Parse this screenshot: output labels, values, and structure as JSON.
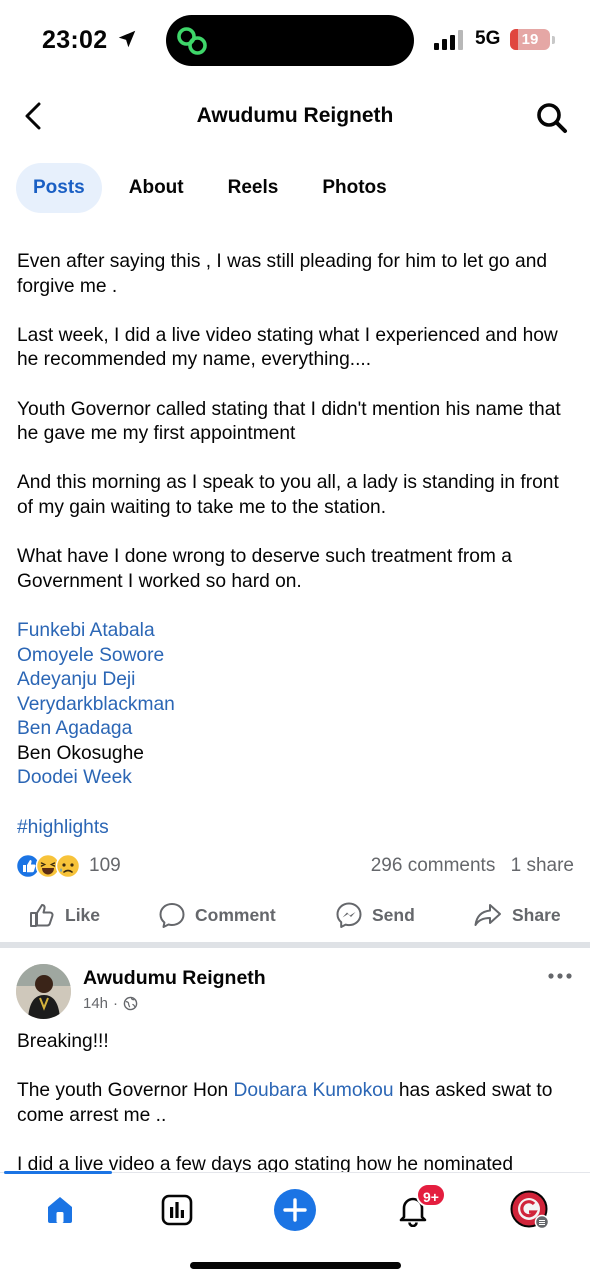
{
  "status_bar": {
    "time": "23:02",
    "network": "5G",
    "battery_level": "19",
    "battery_fraction": 0.19,
    "battery_color": "#e0463f"
  },
  "header": {
    "title": "Awudumu Reigneth",
    "back_icon": "chevron-left-icon",
    "search_icon": "search-icon"
  },
  "tabs": [
    {
      "label": "Posts",
      "active": true
    },
    {
      "label": "About",
      "active": false
    },
    {
      "label": "Reels",
      "active": false
    },
    {
      "label": "Photos",
      "active": false
    }
  ],
  "post": {
    "paragraphs": [
      "Even after saying this , I was still pleading for him to let go and forgive me .",
      "Last week, I did a live video stating what I experienced and how he recommended my name, everything....",
      "Youth Governor called stating that I didn't mention his name that he gave me my first appointment",
      "And this morning as I speak to you all, a lady is standing in front of my gain waiting to take me to the station.",
      "What have I done wrong to deserve such treatment from a Government I worked so hard on."
    ],
    "tags": [
      {
        "text": "Funkebi Atabala",
        "link": true
      },
      {
        "text": "Omoyele Sowore",
        "link": true
      },
      {
        "text": "Adeyanju Deji",
        "link": true
      },
      {
        "text": "Verydarkblackman",
        "link": true
      },
      {
        "text": "Ben Agadaga",
        "link": true
      },
      {
        "text": "Ben Okosughe",
        "link": false
      },
      {
        "text": "Doodei Week",
        "link": true
      }
    ],
    "hashtag": "#highlights",
    "reaction_count": "109",
    "comments": "296 comments",
    "shares": "1 share",
    "actions": {
      "like": "Like",
      "comment": "Comment",
      "send": "Send",
      "share": "Share"
    }
  },
  "post2": {
    "author": "Awudumu Reigneth",
    "time": "14h",
    "line1": "Breaking!!!",
    "line2_before": "The youth Governor Hon ",
    "line2_mention": "Doubara Kumokou",
    "line2_after": " has asked swat to come arrest me ..",
    "line3": "I did a live video a few days ago stating how he nominated"
  },
  "bottom_nav": {
    "notifications_badge": "9+",
    "accent_color": "#1b74e4"
  }
}
